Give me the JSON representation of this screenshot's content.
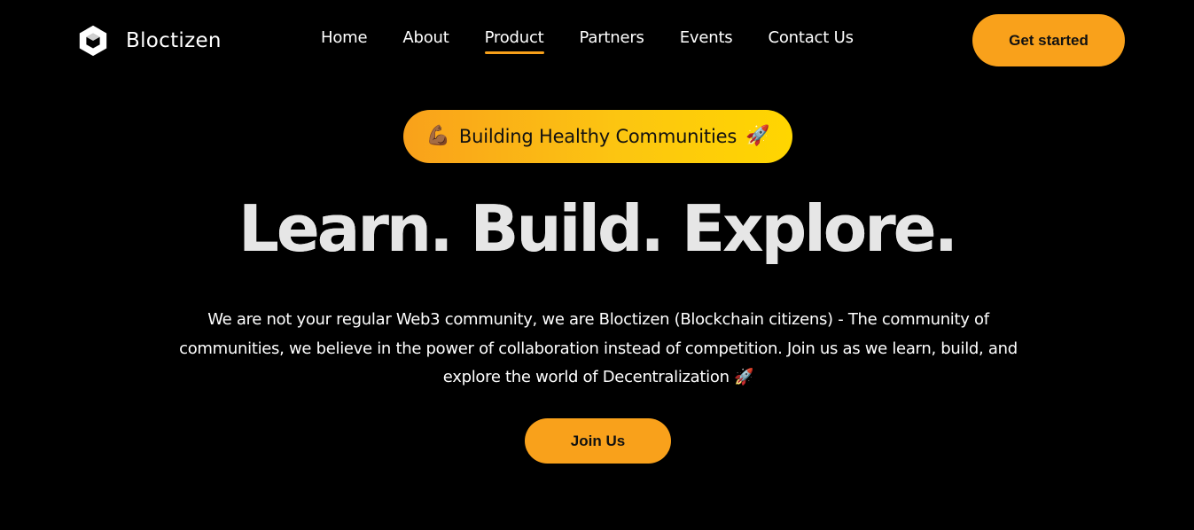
{
  "header": {
    "brand_name": "Bloctizen",
    "logo_icon": "hexagon-cube-icon",
    "nav_items": [
      {
        "label": "Home",
        "active": false
      },
      {
        "label": "About",
        "active": false
      },
      {
        "label": "Product",
        "active": true
      },
      {
        "label": "Partners",
        "active": false
      },
      {
        "label": "Events",
        "active": false
      },
      {
        "label": "Contact Us",
        "active": false
      }
    ],
    "cta_label": "Get started"
  },
  "hero": {
    "badge": {
      "leading_emoji": "💪🏾",
      "text": "Building Healthy Communities",
      "trailing_emoji": "🚀"
    },
    "title": "Learn. Build. Explore.",
    "description": "We are not your regular Web3 community, we are Bloctizen (Blockchain citizens) - The community of communities, we believe in the power of collaboration instead of competition. Join us as we learn, build, and explore the world of Decentralization 🚀",
    "join_label": "Join Us"
  },
  "colors": {
    "background": "#000000",
    "accent": "#f9a11b",
    "badge_gradient_end": "#ffd600",
    "text": "#ffffff"
  }
}
